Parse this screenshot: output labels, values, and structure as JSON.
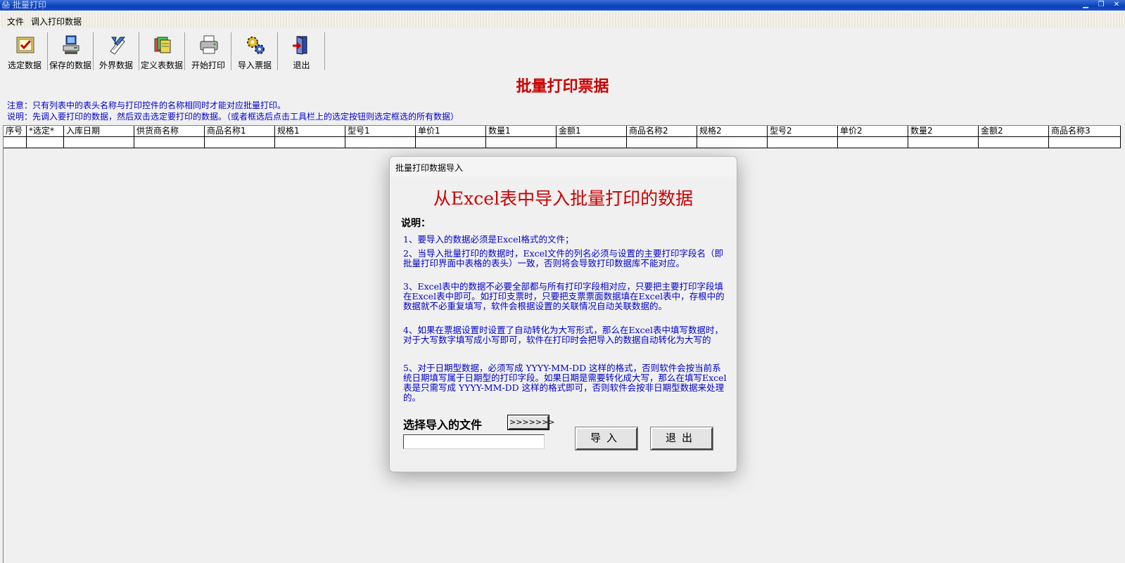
{
  "window": {
    "title": "批量打印"
  },
  "menu": {
    "items": [
      "文件",
      "调入打印数据"
    ]
  },
  "toolbar": {
    "buttons": [
      {
        "label": "选定数据",
        "icon": "checklist-icon"
      },
      {
        "label": "保存的数据",
        "icon": "computer-icon"
      },
      {
        "label": "外界数据",
        "icon": "import-document-icon"
      },
      {
        "label": "定义表数据",
        "icon": "folders-icon"
      },
      {
        "label": "开始打印",
        "icon": "printer-icon"
      },
      {
        "label": "导入票据",
        "icon": "gears-icon"
      },
      {
        "label": "退出",
        "icon": "exit-door-icon"
      }
    ]
  },
  "page": {
    "title": "批量打印票据",
    "notice": "注意：只有列表中的表头名称与打印控件的名称相同时才能对应批量打印。",
    "instruction": "说明：先调入要打印的数据，然后双击选定要打印的数据。（或者框选后点击工具栏上的选定按钮则选定框选的所有数据）"
  },
  "grid": {
    "columns": [
      "序号",
      "*选定*",
      "入库日期",
      "供货商名称",
      "商品名称1",
      "规格1",
      "型号1",
      "单价1",
      "数量1",
      "金额1",
      "商品名称2",
      "规格2",
      "型号2",
      "单价2",
      "数量2",
      "金额2",
      "商品名称3"
    ]
  },
  "dialog": {
    "title": "批量打印数据导入",
    "heading": "从Excel表中导入批量打印的数据",
    "subheading": "说明：",
    "paragraphs": [
      "1、要导入的数据必须是Excel格式的文件；",
      "2、当导入批量打印的数据时，Excel文件的列名必须与设置的主要打印字段名（即批量打印界面中表格的表头）一致，否则将会导致打印数据库不能对应。",
      "3、Excel表中的数据不必要全部都与所有打印字段相对应，只要把主要打印字段填在Excel表中即可。如打印支票时，只要把支票票面数据填在Excel表中，存根中的数据就不必重复填写，软件会根据设置的关联情况自动关联数据的。",
      "4、如果在票据设置时设置了自动转化为大写形式，那么在Excel表中填写数据时，对于大写数字填写成小写即可，软件在打印时会把导入的数据自动转化为大写的",
      "5、对于日期型数据，必须写成 YYYY-MM-DD 这样的格式，否则软件会按当前系统日期填写属于日期型的打印字段。如果日期是需要转化成大写，那么在填写Excel表是只需写成 YYYY-MM-DD 这样的格式即可，否则软件会按非日期型数据来处理的。"
    ],
    "file_label": "选择导入的文件",
    "browse_label": ">>>>>>>",
    "file_value": "",
    "import_label": "导入",
    "exit_label": "退出"
  }
}
